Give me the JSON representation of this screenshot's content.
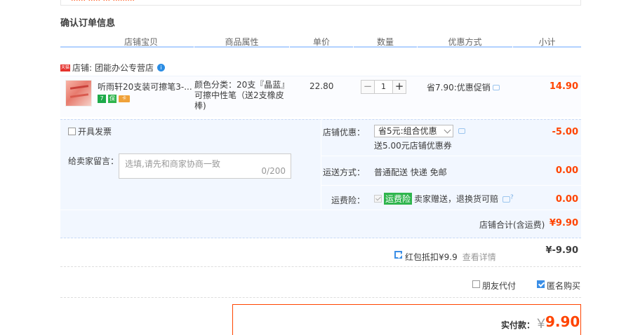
{
  "top_fragment": "······ ····· ··· ·········",
  "section_title": "确认订单信息",
  "columns": [
    "店铺宝贝",
    "商品属性",
    "单价",
    "数量",
    "优惠方式",
    "小计"
  ],
  "shop": {
    "badge": "天猫",
    "label": "店铺:",
    "name": "团能办公专营店",
    "ww_icon": "i"
  },
  "item": {
    "title": "听雨轩20支装可擦笔3-...",
    "service_icons": [
      "7",
      "保",
      "卡"
    ],
    "props": "颜色分类：20支『晶蓝』可擦中性笔（送2支橡皮棒)",
    "price": "22.80",
    "quantity": "1",
    "minus": "−",
    "plus": "+",
    "promo": "省7.90:优惠促销",
    "subtotal": "14.90"
  },
  "invoice": {
    "label": "开具发票"
  },
  "message": {
    "label": "给卖家留言：",
    "placeholder": "选填,请先和商家协商一致",
    "counter": "0/200"
  },
  "shop_discount": {
    "label": "店铺优惠：",
    "selected": "省5元:组合优惠",
    "note": "送5.00元店铺优惠券",
    "amount": "-5.00"
  },
  "shipping": {
    "label": "运送方式：",
    "method": "普通配送 快递 免邮",
    "amount": "0.00"
  },
  "insurance": {
    "label": "运费险：",
    "tag": "运费险",
    "text": "卖家赠送，退换货可赔",
    "amount": "0.00"
  },
  "shop_total": {
    "label": "店铺合计(含运费)",
    "amount": "¥9.90"
  },
  "red_packet": {
    "text": "红包抵扣¥9.9",
    "link": "查看详情",
    "amount": "¥-9.90"
  },
  "options": {
    "friend_pay": "朋友代付",
    "anonymous": "匿名购买"
  },
  "pay": {
    "label": "实付款：",
    "currency": "￥",
    "amount": "9.90"
  }
}
